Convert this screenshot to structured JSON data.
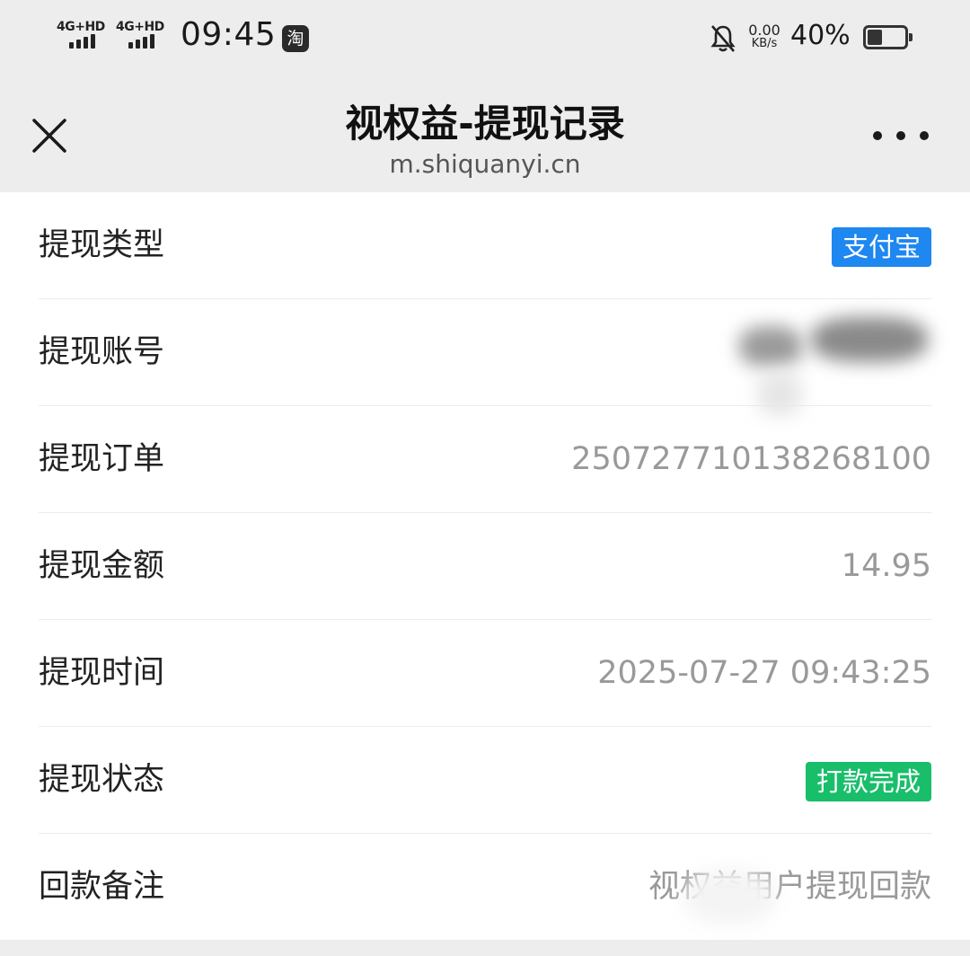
{
  "status_bar": {
    "network1": "4G+HD",
    "network2": "4G+HD",
    "time": "09:45",
    "app_icon": "淘",
    "speed_value": "0.00",
    "speed_unit": "KB/s",
    "battery_percent": "40%",
    "battery_level": 0.4,
    "icons": [
      "signal-icon",
      "bell-off-icon",
      "battery-icon"
    ]
  },
  "nav": {
    "title": "视权益-提现记录",
    "url": "m.shiquanyi.cn",
    "icons": [
      "close-icon",
      "more-icon"
    ]
  },
  "details": {
    "type_label": "提现类型",
    "type_value": "支付宝",
    "account_label": "提现账号",
    "account_value": "",
    "order_label": "提现订单",
    "order_value": "250727710138268100",
    "amount_label": "提现金额",
    "amount_value": "14.95",
    "time_label": "提现时间",
    "time_value": "2025-07-27 09:43:25",
    "status_label": "提现状态",
    "status_value": "打款完成",
    "remark_label": "回款备注",
    "remark_value": "视权益用户提现回款"
  },
  "colors": {
    "alipay_badge": "#1e87f0",
    "success_badge": "#19be6b",
    "page_bg": "#ededed",
    "content_bg": "#ffffff"
  }
}
